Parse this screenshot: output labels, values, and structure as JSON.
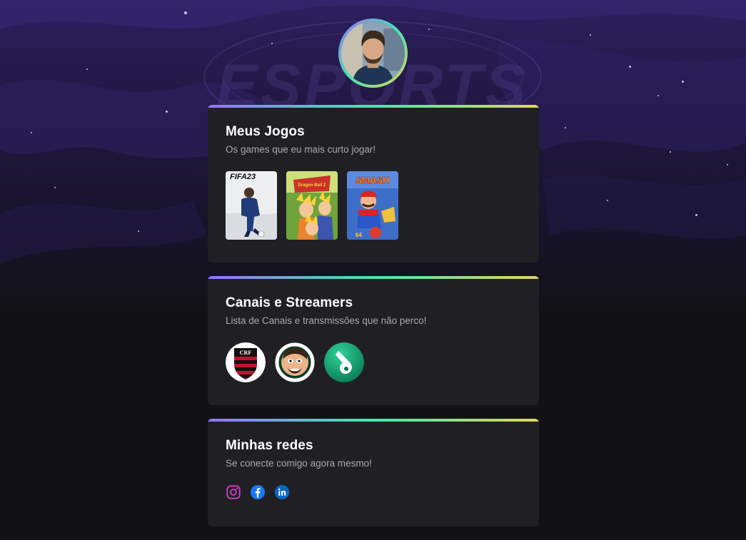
{
  "background": {
    "watermark_text": "ESPORTS",
    "colors": {
      "top": "#2d1f5e",
      "bottom": "#121214"
    }
  },
  "profile": {
    "avatar_alt": "Foto de perfil",
    "ring_gradient": [
      "#9572fc",
      "#43e7ad",
      "#e2d45c"
    ]
  },
  "games": {
    "title": "Meus Jogos",
    "subtitle": "Os games que eu mais curto jogar!",
    "items": [
      {
        "name": "FIFA 23",
        "cover_text": "FIFA23"
      },
      {
        "name": "Dragon Ball Z Budokai Tenkaichi 3",
        "cover_text": "Dragon Ball Z"
      },
      {
        "name": "Super Smash Bros",
        "cover_text": "SMASH"
      }
    ]
  },
  "channels": {
    "title": "Canais e Streamers",
    "subtitle": "Lista de Canais e transmissões que não perco!",
    "items": [
      {
        "name": "Flamengo",
        "icon": "flamengo-crest"
      },
      {
        "name": "Casimiro",
        "icon": "casimiro-logo"
      },
      {
        "name": "Green whistle channel",
        "icon": "whistle-logo"
      }
    ]
  },
  "social": {
    "title": "Minhas redes",
    "subtitle": "Se conecte comigo agora mesmo!",
    "items": [
      {
        "name": "Instagram",
        "icon": "instagram-icon",
        "color": "#d03fc7"
      },
      {
        "name": "Facebook",
        "icon": "facebook-icon",
        "color": "#1877f2"
      },
      {
        "name": "LinkedIn",
        "icon": "linkedin-icon",
        "color": "#0a66c2"
      }
    ]
  }
}
